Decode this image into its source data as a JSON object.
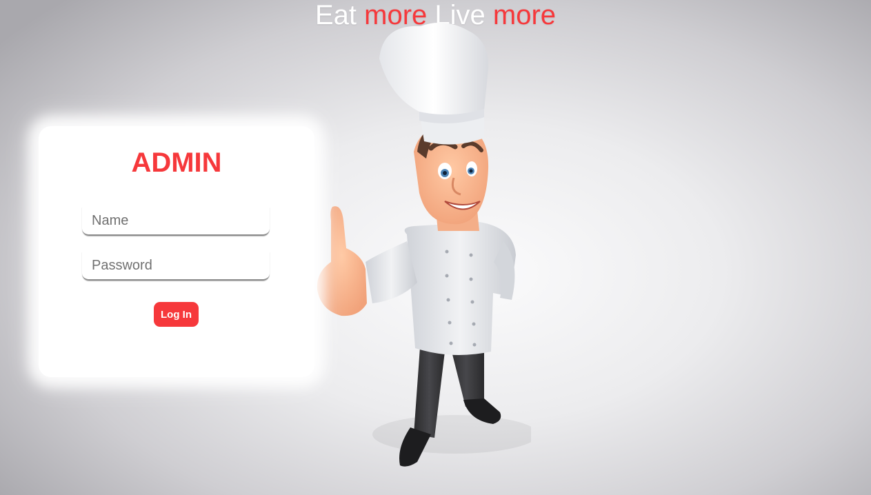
{
  "headline": {
    "word1": "Eat",
    "word2": "more",
    "word3": "Live",
    "word4": "more"
  },
  "login": {
    "title": "ADMIN",
    "name_placeholder": "Name",
    "name_value": "",
    "password_placeholder": "Password",
    "password_value": "",
    "submit_label": "Log In"
  },
  "illustration": "chef-thumbs-up-icon",
  "colors": {
    "accent": "#f6383b",
    "card_background": "#ffffff",
    "headline_text": "#ffffff"
  }
}
